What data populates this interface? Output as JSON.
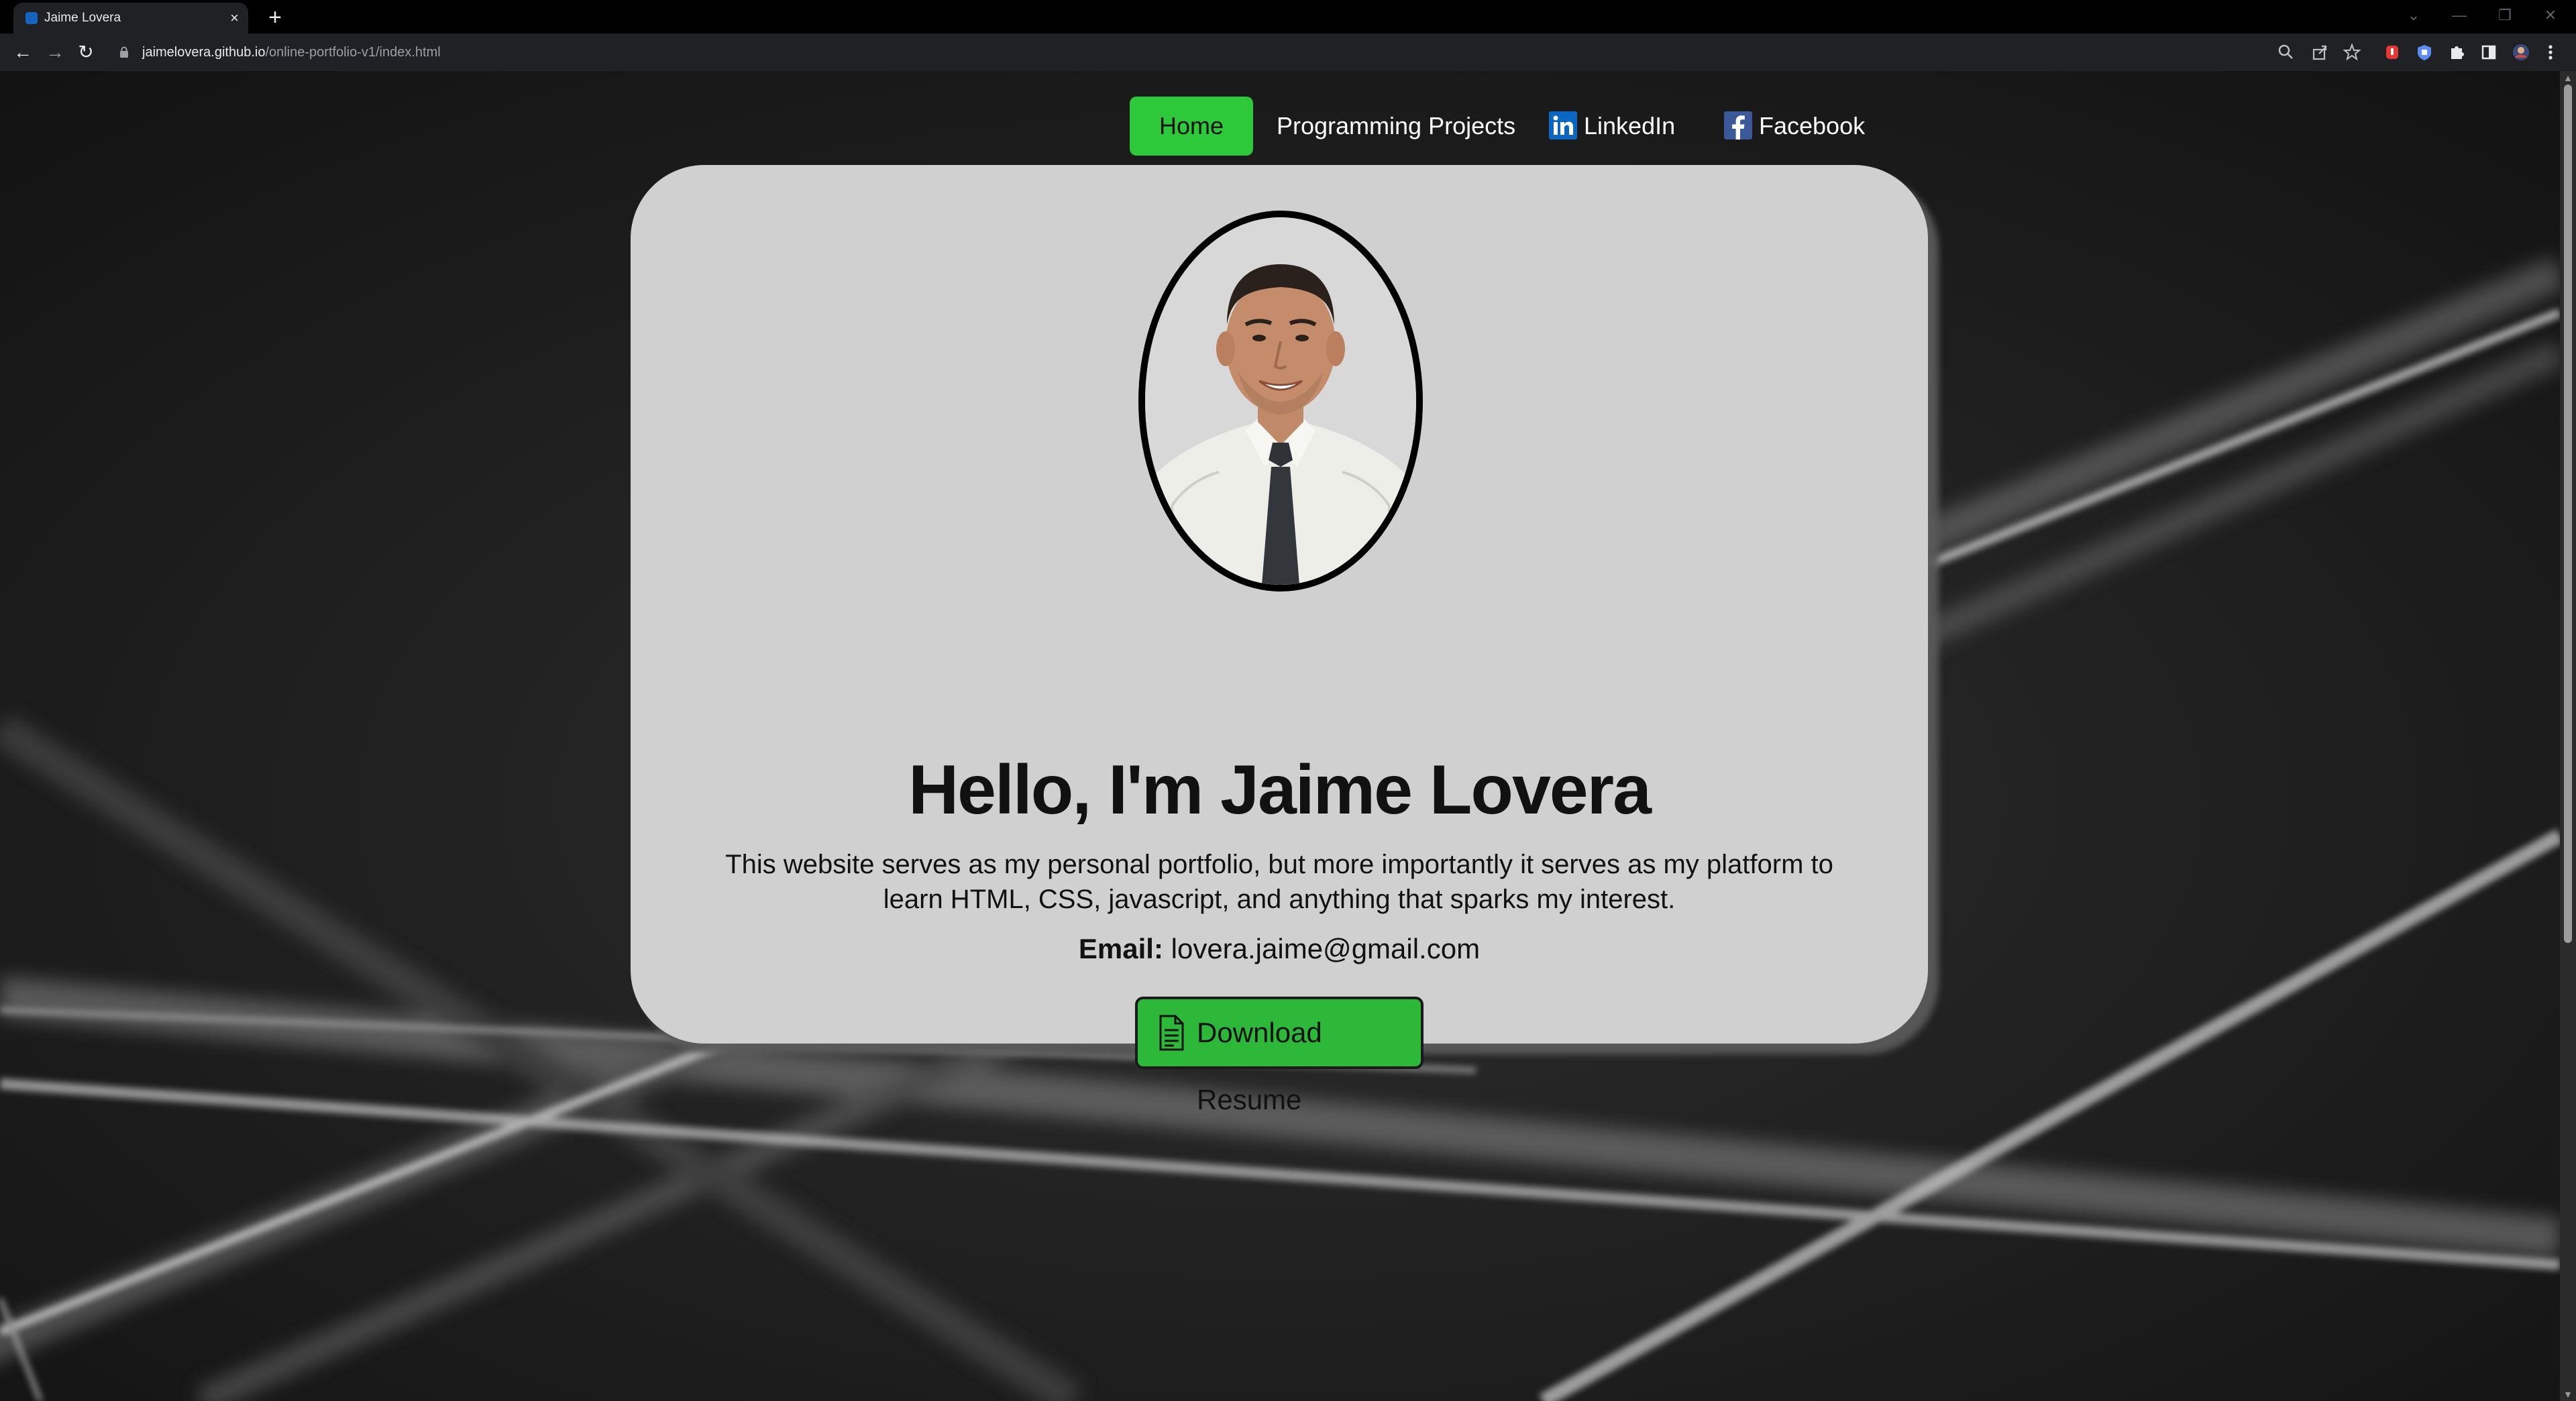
{
  "browser": {
    "tab": {
      "title": "Jaime Lovera",
      "close": "×"
    },
    "new_tab": "+",
    "window_controls": [
      "⌄",
      "—",
      "❐",
      "✕"
    ],
    "nav": {
      "back": "←",
      "forward": "→",
      "reload": "↻"
    },
    "url": {
      "host": "jaimelovera.github.io",
      "path": "/online-portfolio-v1/index.html"
    },
    "toolbar_icons": [
      "zoom-icon",
      "share-icon",
      "bookmark-star-icon",
      "extension-red-icon",
      "extension-shield-icon",
      "extensions-puzzle-icon",
      "side-panel-icon",
      "profile-avatar-icon",
      "menu-kebab-icon"
    ]
  },
  "site": {
    "nav": {
      "home": "Home",
      "projects": "Programming Projects",
      "linkedin": "LinkedIn",
      "facebook": "Facebook"
    },
    "heading": "Hello, I'm Jaime Lovera",
    "intro": "This website serves as my personal portfolio, but more importantly it serves as my platform to learn HTML, CSS, javascript, and anything that sparks my interest.",
    "email_label": "Email:",
    "email_value": "lovera.jaime@gmail.com",
    "download_button": "Download Resume"
  },
  "colors": {
    "accent_green": "#2ec93a",
    "card_bg": "#d0d0d0",
    "page_bg": "#1a1a1a",
    "linkedin_blue": "#0a66c2",
    "facebook_blue": "#3b5998"
  }
}
